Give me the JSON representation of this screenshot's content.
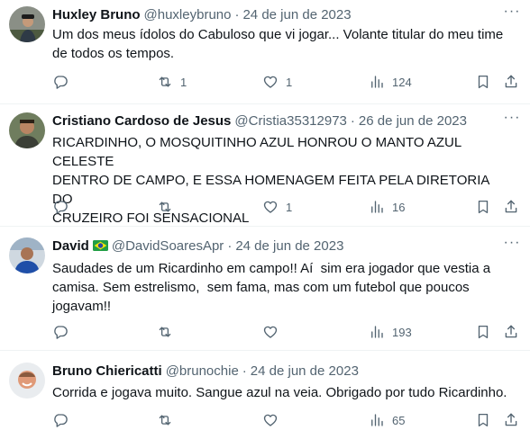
{
  "tweets": [
    {
      "name": "Huxley Bruno",
      "handle": "@huxleybruno",
      "separator": "·",
      "date": "24 de jun de 2023",
      "text": "Um dos meus ídolos do Cabuloso que vi jogar... Volante titular do meu time\nde todos os tempos.",
      "replies": "",
      "retweets": "1",
      "likes": "1",
      "views": "124",
      "more": "···"
    },
    {
      "name": "Cristiano Cardoso de Jesus",
      "handle": "@Cristia35312973",
      "separator": "·",
      "date": "26 de jun de 2023",
      "text": "RICARDINHO, O MOSQUITINHO AZUL HONROU O MANTO AZUL CELESTE\nDENTRO DE CAMPO, E ESSA HOMENAGEM FEITA PELA DIRETORIA DO\nCRUZEIRO FOI SENSACIONAL",
      "replies": "",
      "retweets": "",
      "likes": "1",
      "views": "16",
      "more": "···"
    },
    {
      "name": "David",
      "handle": "@DavidSoaresApr",
      "separator": "·",
      "date": "24 de jun de 2023",
      "text": "Saudades de um Ricardinho em campo!! Aí  sim era jogador que vestia a\ncamisa. Sem estrelismo,  sem fama, mas com um futebol que poucos\njogavam!!",
      "replies": "",
      "retweets": "",
      "likes": "",
      "views": "193",
      "more": "···"
    },
    {
      "name": "Bruno Chiericatti",
      "handle": "@brunochie",
      "separator": "·",
      "date": "24 de jun de 2023",
      "text": "Corrida e jogava muito. Sangue azul na veia. Obrigado por tudo Ricardinho.",
      "replies": "",
      "retweets": "",
      "likes": "",
      "views": "65",
      "more": ""
    }
  ],
  "colors": {
    "text": "#0f1419",
    "secondary": "#536471",
    "divider": "#eff3f4"
  },
  "icons": [
    "reply-icon",
    "retweet-icon",
    "like-icon",
    "views-icon",
    "bookmark-icon",
    "share-icon",
    "more-icon",
    "brazil-flag-icon"
  ]
}
